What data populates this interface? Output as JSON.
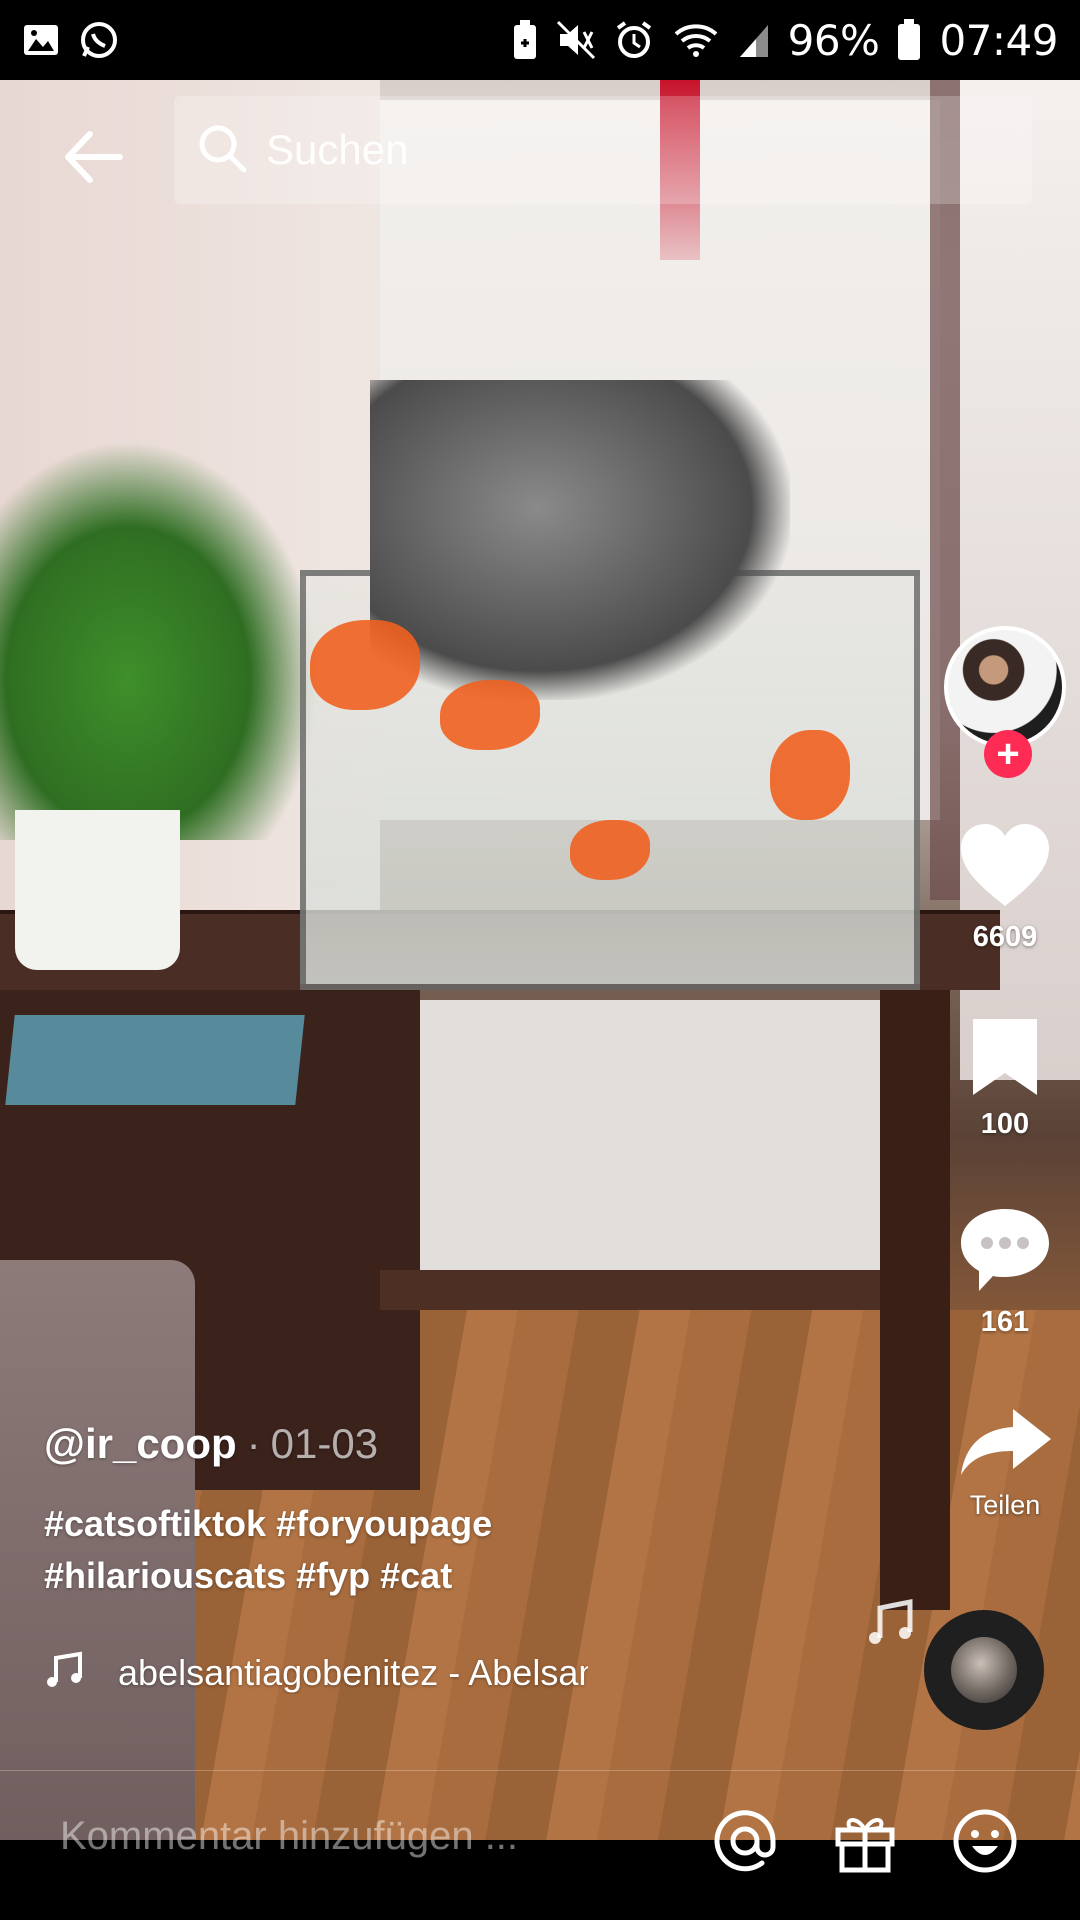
{
  "status_bar": {
    "battery_percent": "96%",
    "time": "07:49",
    "icons": [
      "gallery-icon",
      "whatsapp-icon",
      "battery-saver-icon",
      "mute-icon",
      "alarm-icon",
      "wifi-icon",
      "signal-icon",
      "battery-icon"
    ]
  },
  "search": {
    "placeholder": "Suchen"
  },
  "video": {
    "likes": "6609",
    "bookmarks": "100",
    "comments": "161",
    "share_label": "Teilen",
    "author": "@ir_coop",
    "date_separator": "·",
    "date": "01-03",
    "hashtags": "#catsoftiktok #foryoupage #hilariouscats #fyp #cat",
    "music": "abelsantiagobenitez - Abelsantiagobenitez"
  },
  "comment_bar": {
    "placeholder": "Kommentar hinzufügen ...",
    "icons": [
      "at-icon",
      "gift-icon",
      "emoji-icon"
    ]
  },
  "colors": {
    "accent": "#fe2c55",
    "status_bar_bg": "#000000"
  }
}
